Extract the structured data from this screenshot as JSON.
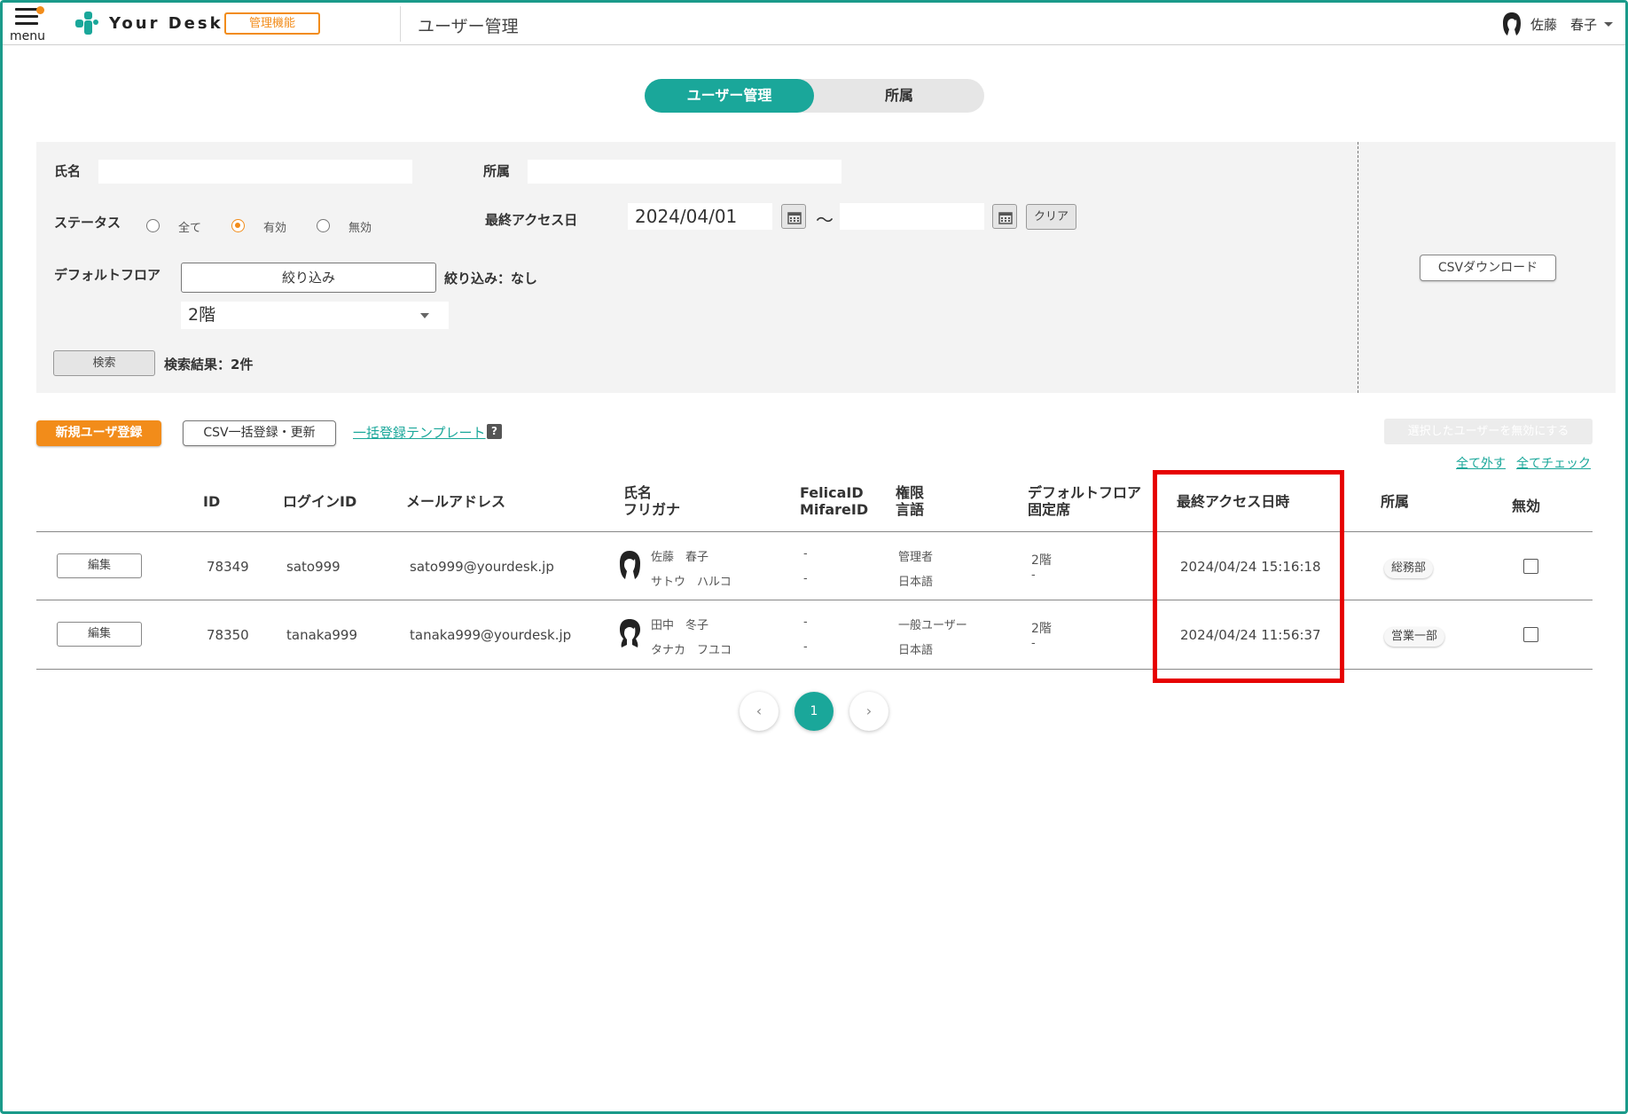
{
  "header": {
    "menu_label": "menu",
    "logo_text": "Your Desk",
    "admin_badge": "管理機能",
    "page_title": "ユーザー管理",
    "user_name": "佐藤　春子"
  },
  "tabs": [
    {
      "label": "ユーザー管理",
      "active": true
    },
    {
      "label": "所属",
      "active": false
    }
  ],
  "search": {
    "name_label": "氏名",
    "name_value": "",
    "dept_label": "所属",
    "dept_value": "",
    "status_label": "ステータス",
    "status_options": [
      "全て",
      "有効",
      "無効"
    ],
    "status_selected": "有効",
    "last_access_label": "最終アクセス日",
    "date_from": "2024/04/01",
    "date_sep": "〜",
    "date_to": "",
    "clear_label": "クリア",
    "default_floor_label": "デフォルトフロア",
    "filter_button": "絞り込み",
    "filter_status": "絞り込み：なし",
    "floor_selected": "2階",
    "search_button": "検索",
    "result_text": "検索結果：2件",
    "csv_download": "CSVダウンロード"
  },
  "actions": {
    "new_user": "新規ユーザ登録",
    "csv_bulk": "CSV一括登録・更新",
    "template_link": "一括登録テンプレート",
    "help": "?",
    "disable_selected": "選択したユーザーを無効にする",
    "uncheck_all": "全て外す",
    "check_all": "全てチェック"
  },
  "table": {
    "headers": {
      "id": "ID",
      "login_id": "ログインID",
      "email": "メールアドレス",
      "name": "氏名",
      "furigana": "フリガナ",
      "felica": "FelicaID",
      "mifare": "MifareID",
      "role": "権限",
      "language": "言語",
      "default_floor": "デフォルトフロア",
      "fixed_seat": "固定席",
      "last_access": "最終アクセス日時",
      "department": "所属",
      "disabled": "無効"
    },
    "edit_label": "編集",
    "rows": [
      {
        "id": "78349",
        "login_id": "sato999",
        "email": "sato999@yourdesk.jp",
        "name": "佐藤　春子",
        "furigana": "サトウ　ハルコ",
        "felica": "-",
        "mifare": "-",
        "role": "管理者",
        "language": "日本語",
        "floor": "2階",
        "seat": "-",
        "last_access": "2024/04/24 15:16:18",
        "department": "総務部",
        "disabled": false
      },
      {
        "id": "78350",
        "login_id": "tanaka999",
        "email": "tanaka999@yourdesk.jp",
        "name": "田中　冬子",
        "furigana": "タナカ　フユコ",
        "felica": "-",
        "mifare": "-",
        "role": "一般ユーザー",
        "language": "日本語",
        "floor": "2階",
        "seat": "-",
        "last_access": "2024/04/24 11:56:37",
        "department": "営業一部",
        "disabled": false
      }
    ]
  },
  "pagination": {
    "prev": "‹",
    "current": "1",
    "next": "›"
  },
  "colors": {
    "accent": "#1aa79a",
    "orange": "#f28c1a",
    "highlight": "#e60000"
  }
}
